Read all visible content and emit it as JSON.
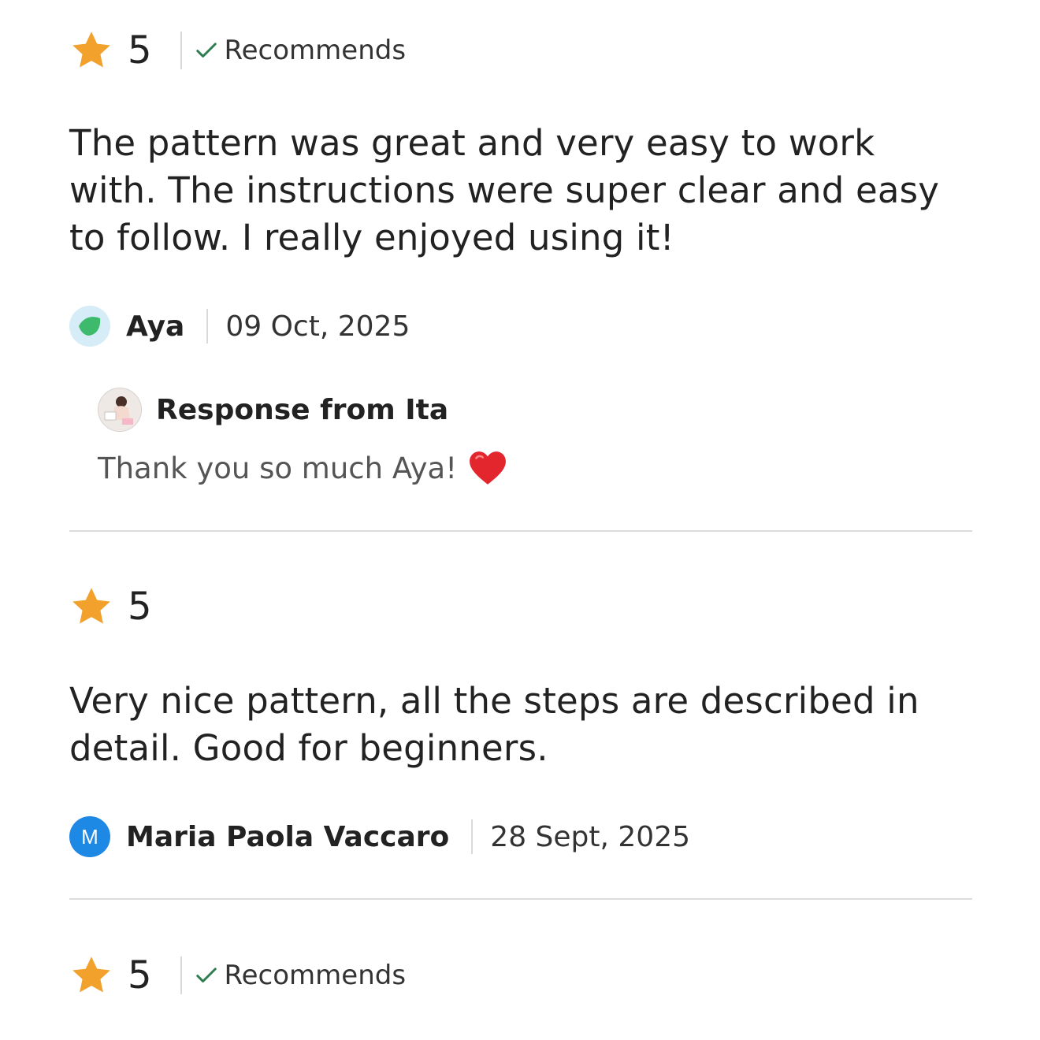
{
  "reviews": [
    {
      "rating": "5",
      "recommends_label": "Recommends",
      "text": "The pattern was great and very easy to work with. The instructions were super clear and easy to follow. I really enjoyed using it!",
      "author": "Aya",
      "date": "09 Oct, 2025",
      "response": {
        "title": "Response from Ita",
        "text": "Thank you so much Aya!",
        "icon": "heart-icon"
      }
    },
    {
      "rating": "5",
      "text": "Very nice pattern, all the steps are described in detail. Good for beginners.",
      "author": "Maria Paola Vaccaro",
      "author_initial": "M",
      "date": "28 Sept, 2025"
    },
    {
      "rating": "5",
      "recommends_label": "Recommends"
    }
  ],
  "colors": {
    "star": "#F2A12C",
    "check": "#2E7D4F",
    "avatar_blue": "#1E88E5",
    "avatar_green": "#3DBA6C",
    "avatar_green_bg": "#D6ECF7",
    "heart": "#E3262E"
  }
}
